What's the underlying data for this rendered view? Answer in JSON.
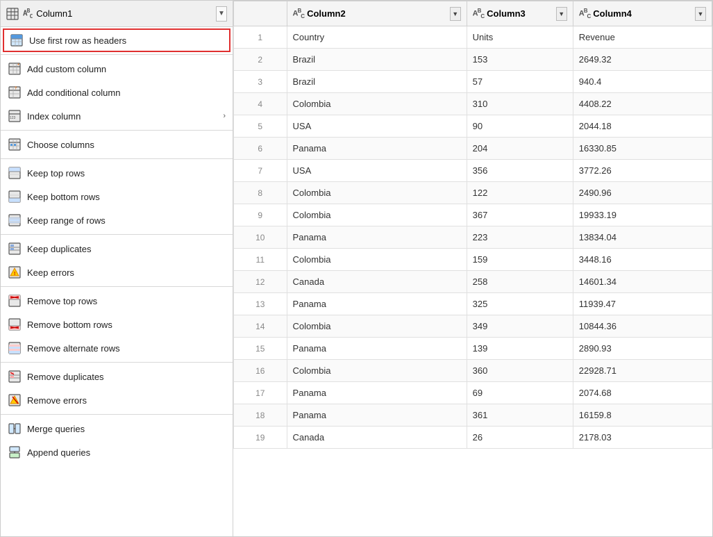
{
  "header": {
    "column1": "Column1",
    "column1_icon": "ABC",
    "dropdown_arrow": "▼"
  },
  "columns": [
    {
      "id": "col1",
      "type_icon": "",
      "label": ""
    },
    {
      "id": "col2",
      "type_icon": "ABC",
      "label": "Column2"
    },
    {
      "id": "col3",
      "type_icon": "ABC",
      "label": "Column3"
    },
    {
      "id": "col4",
      "type_icon": "ABC",
      "label": "Column4"
    }
  ],
  "table_rows": [
    [
      "Country",
      "Units",
      "Revenue"
    ],
    [
      "Brazil",
      "153",
      "2649.32"
    ],
    [
      "Brazil",
      "57",
      "940.4"
    ],
    [
      "Colombia",
      "310",
      "4408.22"
    ],
    [
      "USA",
      "90",
      "2044.18"
    ],
    [
      "Panama",
      "204",
      "16330.85"
    ],
    [
      "USA",
      "356",
      "3772.26"
    ],
    [
      "Colombia",
      "122",
      "2490.96"
    ],
    [
      "Colombia",
      "367",
      "19933.19"
    ],
    [
      "Panama",
      "223",
      "13834.04"
    ],
    [
      "Colombia",
      "159",
      "3448.16"
    ],
    [
      "Canada",
      "258",
      "14601.34"
    ],
    [
      "Panama",
      "325",
      "11939.47"
    ],
    [
      "Colombia",
      "349",
      "10844.36"
    ],
    [
      "Panama",
      "139",
      "2890.93"
    ],
    [
      "Colombia",
      "360",
      "22928.71"
    ],
    [
      "Panama",
      "69",
      "2074.68"
    ],
    [
      "Panama",
      "361",
      "16159.8"
    ],
    [
      "Canada",
      "26",
      "2178.03"
    ]
  ],
  "menu": {
    "items": [
      {
        "id": "use-first-row-headers",
        "label": "Use first row as headers",
        "icon": "table-header",
        "has_arrow": false,
        "highlighted": true
      },
      {
        "id": "divider1",
        "type": "divider"
      },
      {
        "id": "add-custom-column",
        "label": "Add custom column",
        "icon": "custom-col",
        "has_arrow": false,
        "highlighted": false
      },
      {
        "id": "add-conditional-column",
        "label": "Add conditional column",
        "icon": "cond-col",
        "has_arrow": false,
        "highlighted": false
      },
      {
        "id": "index-column",
        "label": "Index column",
        "icon": "index-col",
        "has_arrow": true,
        "highlighted": false
      },
      {
        "id": "divider2",
        "type": "divider"
      },
      {
        "id": "choose-columns",
        "label": "Choose columns",
        "icon": "choose-col",
        "has_arrow": false,
        "highlighted": false
      },
      {
        "id": "divider3",
        "type": "divider"
      },
      {
        "id": "keep-top-rows",
        "label": "Keep top rows",
        "icon": "keep-top",
        "has_arrow": false,
        "highlighted": false
      },
      {
        "id": "keep-bottom-rows",
        "label": "Keep bottom rows",
        "icon": "keep-bottom",
        "has_arrow": false,
        "highlighted": false
      },
      {
        "id": "keep-range-rows",
        "label": "Keep range of rows",
        "icon": "keep-range",
        "has_arrow": false,
        "highlighted": false
      },
      {
        "id": "divider4",
        "type": "divider"
      },
      {
        "id": "keep-duplicates",
        "label": "Keep duplicates",
        "icon": "keep-dup",
        "has_arrow": false,
        "highlighted": false
      },
      {
        "id": "keep-errors",
        "label": "Keep errors",
        "icon": "keep-err",
        "has_arrow": false,
        "highlighted": false
      },
      {
        "id": "divider5",
        "type": "divider"
      },
      {
        "id": "remove-top-rows",
        "label": "Remove top rows",
        "icon": "remove-top",
        "has_arrow": false,
        "highlighted": false
      },
      {
        "id": "remove-bottom-rows",
        "label": "Remove bottom rows",
        "icon": "remove-bottom",
        "has_arrow": false,
        "highlighted": false
      },
      {
        "id": "remove-alternate-rows",
        "label": "Remove alternate rows",
        "icon": "remove-alt",
        "has_arrow": false,
        "highlighted": false
      },
      {
        "id": "divider6",
        "type": "divider"
      },
      {
        "id": "remove-duplicates",
        "label": "Remove duplicates",
        "icon": "remove-dup",
        "has_arrow": false,
        "highlighted": false
      },
      {
        "id": "remove-errors",
        "label": "Remove errors",
        "icon": "remove-err",
        "has_arrow": false,
        "highlighted": false
      },
      {
        "id": "divider7",
        "type": "divider"
      },
      {
        "id": "merge-queries",
        "label": "Merge queries",
        "icon": "merge",
        "has_arrow": false,
        "highlighted": false
      },
      {
        "id": "append-queries",
        "label": "Append queries",
        "icon": "append",
        "has_arrow": false,
        "highlighted": false
      }
    ]
  }
}
